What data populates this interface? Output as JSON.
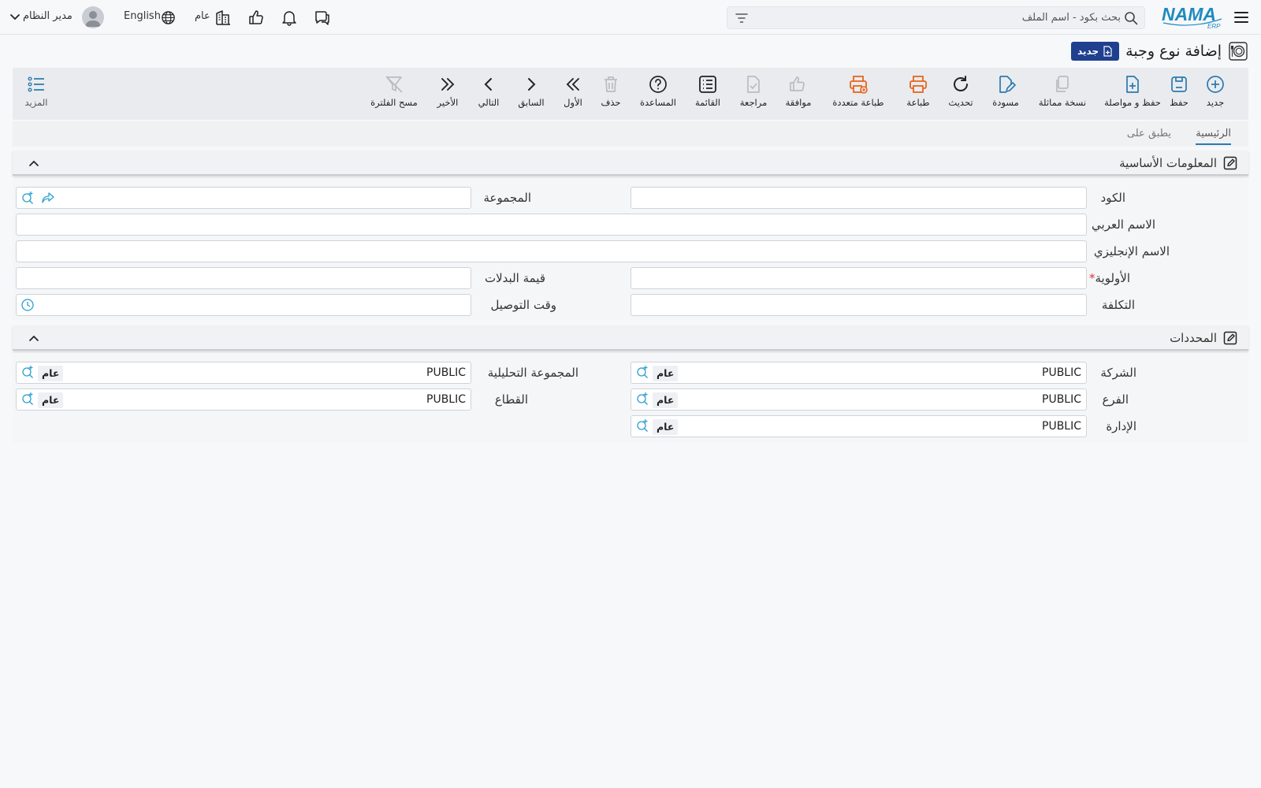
{
  "topbar": {
    "search_placeholder": "بحث بكود - اسم الملف",
    "language": "English",
    "company_scope": "عام",
    "user_name": "مدير النظام"
  },
  "page": {
    "title": "إضافة نوع وجبة",
    "badge": "جديد"
  },
  "actions": {
    "new": "جديد",
    "save": "حفظ",
    "save_continue": "حفظ و مواصلة",
    "duplicate": "نسخة مماثلة",
    "draft": "مسودة",
    "refresh": "تحديث",
    "print": "طباعة",
    "multi_print": "طباعة متعددة",
    "approve": "موافقة",
    "review": "مراجعة",
    "list": "القائمة",
    "help": "المساعدة",
    "delete": "حذف",
    "first": "الأول",
    "previous": "السابق",
    "next": "التالي",
    "last": "الأخير",
    "clear_filter": "مسح الفلترة",
    "more": "المزيد"
  },
  "tabs": {
    "main": "الرئيسية",
    "applies_to": "يطبق على"
  },
  "basic_info": {
    "title": "المعلومات الأساسية",
    "code_label": "الكود",
    "code_value": "",
    "group_label": "المجموعة",
    "group_value": "",
    "arabic_name_label": "الاسم العربي",
    "arabic_name_value": "",
    "english_name_label": "الاسم الإنجليزي",
    "english_name_value": "",
    "priority_label": "الأولوية",
    "priority_required": "*",
    "priority_value": "",
    "allowance_label": "قيمة البدلات",
    "allowance_value": "",
    "cost_label": "التكلفة",
    "cost_value": "",
    "delivery_time_label": "وقت التوصيل",
    "delivery_time_value": ""
  },
  "dimensions": {
    "title": "المحددات",
    "company_label": "الشركة",
    "company_value": "PUBLIC",
    "company_badge": "عام",
    "analytic_group_label": "المجموعة التحليلية",
    "analytic_group_value": "PUBLIC",
    "analytic_group_badge": "عام",
    "branch_label": "الفرع",
    "branch_value": "PUBLIC",
    "branch_badge": "عام",
    "sector_label": "القطاع",
    "sector_value": "PUBLIC",
    "sector_badge": "عام",
    "department_label": "الإدارة",
    "department_value": "PUBLIC",
    "department_badge": "عام"
  },
  "colors": {
    "accent": "#2a7ab0",
    "print_orange": "#e8641b",
    "badge_blue": "#1f3f8f",
    "disabled_gray": "#b8bcc3"
  }
}
